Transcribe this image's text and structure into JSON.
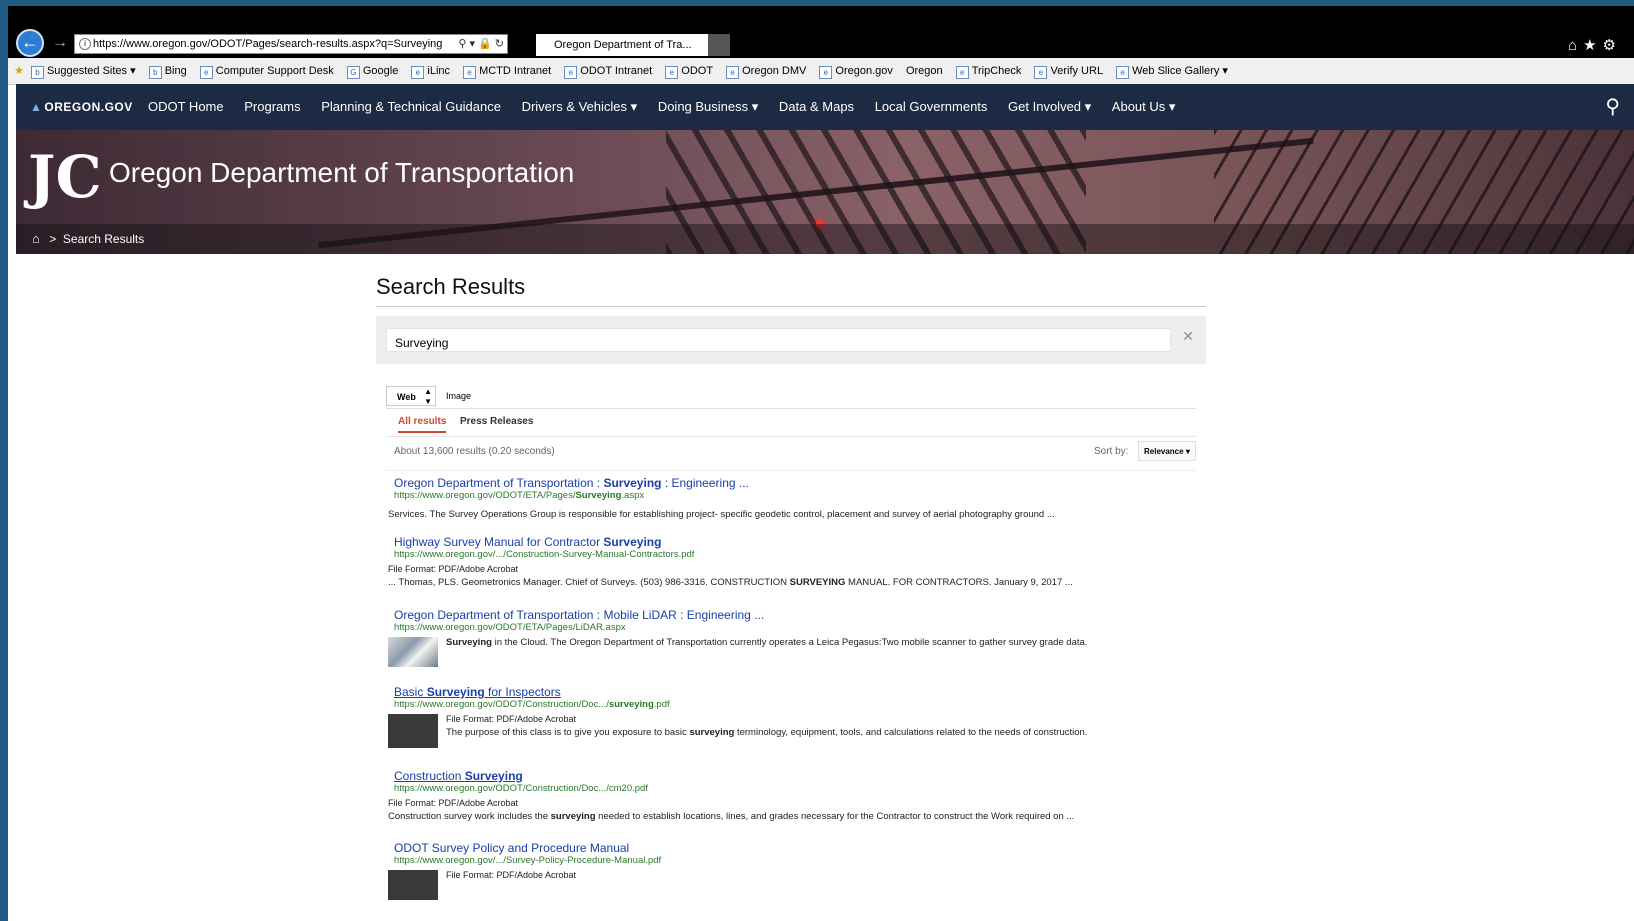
{
  "browser": {
    "address": "https://www.oregon.gov/ODOT/Pages/search-results.aspx?q=Surveying",
    "tab_title": "Oregon Department of Tra...",
    "favorites": [
      "Suggested Sites ▾",
      "Bing",
      "Computer Support Desk",
      "Google",
      "iLinc",
      "MCTD Intranet",
      "ODOT Intranet",
      "ODOT",
      "Oregon DMV",
      "Oregon.gov",
      "Oregon",
      "TripCheck",
      "Verify URL",
      "Web Slice Gallery ▾"
    ]
  },
  "sitenav": {
    "logo": "OREGON.GOV",
    "items": [
      "ODOT Home",
      "Programs",
      "Planning & Technical Guidance",
      "Drivers & Vehicles ▾",
      "Doing Business ▾",
      "Data & Maps",
      "Local Governments",
      "Get Involved ▾",
      "About Us ▾"
    ]
  },
  "hero": {
    "agency": "Oregon Department of Transportation",
    "breadcrumb": "Search Results"
  },
  "page": {
    "title": "Search Results",
    "query": "Surveying",
    "type_selected": "Web",
    "type_other": "Image",
    "tab_all": "All results",
    "tab_press": "Press Releases",
    "count": "About 13,600 results (0.20 seconds)",
    "sort_label": "Sort by:",
    "sort_value": "Relevance"
  },
  "results": [
    {
      "title_pre": "Oregon Department of Transportation : ",
      "title_bold": "Surveying",
      "title_post": " : Engineering ...",
      "url_pre": "https://www.oregon.gov/ODOT/ETA/Pages/",
      "url_bold": "Surveying",
      "url_post": ".aspx",
      "snippet": "Services. The Survey Operations Group is responsible for establishing project- specific geodetic control, placement and survey of aerial photography ground ..."
    },
    {
      "title_pre": "Highway Survey Manual for Contractor ",
      "title_bold": "Surveying",
      "url": "https://www.oregon.gov/.../Construction-Survey-Manual-Contractors.pdf",
      "format": "File Format: PDF/Adobe Acrobat",
      "snippet_pre": "... Thomas, PLS. Geometronics Manager. Chief of Surveys. (503) 986-3316. CONSTRUCTION ",
      "snippet_bold": "SURVEYING",
      "snippet_post": " MANUAL. FOR CONTRACTORS. January 9, 2017 ..."
    },
    {
      "title": "Oregon Department of Transportation : Mobile LiDAR : Engineering ...",
      "url": "https://www.oregon.gov/ODOT/ETA/Pages/LiDAR.aspx",
      "snippet_bold": "Surveying",
      "snippet_post": " in the Cloud. The Oregon Department of Transportation currently operates a Leica Pegasus:Two mobile scanner to gather survey grade data."
    },
    {
      "title_pre": "Basic ",
      "title_bold": "Surveying",
      "title_post": " for Inspectors",
      "url_pre": "https://www.oregon.gov/ODOT/Construction/Doc.../",
      "url_bold": "surveying",
      "url_post": ".pdf",
      "format": "File Format: PDF/Adobe Acrobat",
      "snippet_pre": "The purpose of this class is to give you exposure to basic ",
      "snippet_bold": "surveying",
      "snippet_post": " terminology, equipment, tools, and calculations related to the needs of construction."
    },
    {
      "title_pre": "Construction ",
      "title_bold": "Surveying",
      "url": "https://www.oregon.gov/ODOT/Construction/Doc.../cm20.pdf",
      "format": "File Format: PDF/Adobe Acrobat",
      "snippet_pre": "Construction survey work includes the ",
      "snippet_bold": "surveying",
      "snippet_post": " needed to establish locations, lines, and grades necessary for the Contractor to construct the Work required on  ..."
    },
    {
      "title": "ODOT Survey Policy and Procedure Manual",
      "url": "https://www.oregon.gov/.../Survey-Policy-Procedure-Manual.pdf",
      "format": "File Format: PDF/Adobe Acrobat"
    }
  ]
}
